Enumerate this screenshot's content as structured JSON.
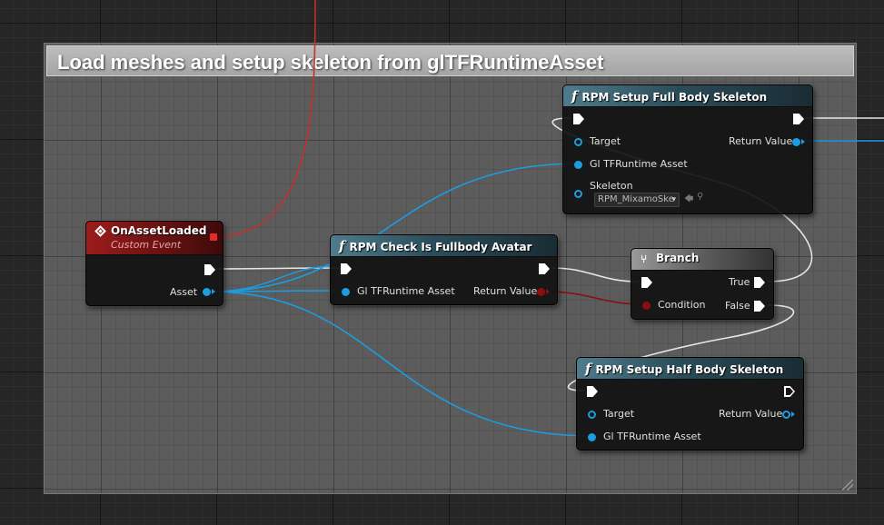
{
  "comment": {
    "title": "Load meshes and setup skeleton from glTFRuntimeAsset"
  },
  "nodes": {
    "on_asset_loaded": {
      "title": "OnAssetLoaded",
      "subtitle": "Custom Event",
      "outputs": {
        "asset": "Asset"
      }
    },
    "check_fullbody": {
      "title": "RPM Check Is Fullbody Avatar",
      "inputs": {
        "gltf_asset": "Gl TFRuntime Asset"
      },
      "outputs": {
        "return_value": "Return Value"
      }
    },
    "setup_full": {
      "title": "RPM Setup Full Body Skeleton",
      "inputs": {
        "target": "Target",
        "gltf_asset": "Gl TFRuntime Asset",
        "skeleton": "Skeleton",
        "skeleton_value": "RPM_MixamoSke"
      },
      "outputs": {
        "return_value": "Return Value"
      }
    },
    "branch": {
      "title": "Branch",
      "inputs": {
        "condition": "Condition"
      },
      "outputs": {
        "true_label": "True",
        "false_label": "False"
      }
    },
    "setup_half": {
      "title": "RPM Setup Half Body Skeleton",
      "inputs": {
        "target": "Target",
        "gltf_asset": "Gl TFRuntime Asset"
      },
      "outputs": {
        "return_value": "Return Value"
      }
    }
  },
  "icons": {
    "function": "function-icon",
    "event": "event-diamond-icon",
    "branch": "branch-icon",
    "browse": "browse-arrow-icon",
    "search": "search-icon"
  },
  "colors": {
    "object_pin": "#1b9de0",
    "bool_pin": "#8b0f0f",
    "exec_wire": "#e6e6e6",
    "delegate_wire": "#c0312f",
    "event_header": "#9b1c1c",
    "function_header": "#4f7b8c",
    "comment_bg": "#5c5c5c"
  }
}
